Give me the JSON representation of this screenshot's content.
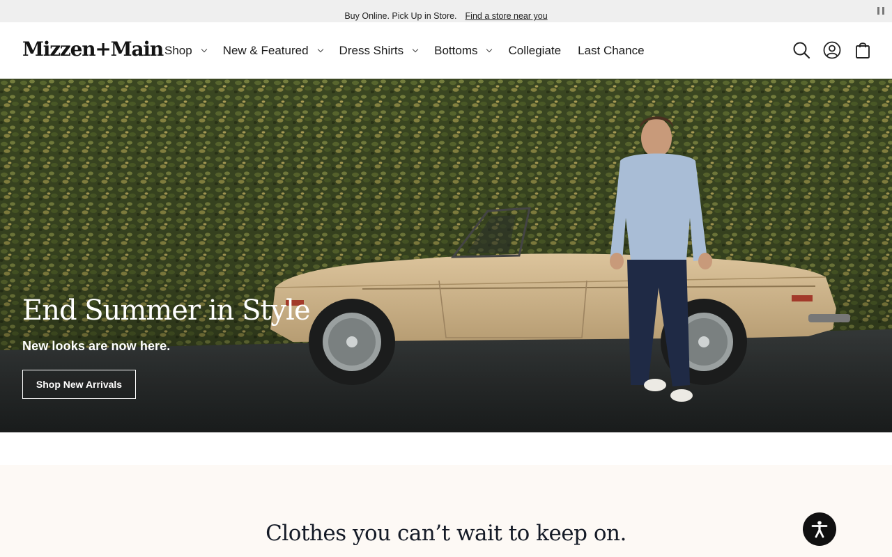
{
  "announcement": {
    "message": "Buy Online. Pick Up in Store.",
    "link": "Find a store near you",
    "pause_icon": "pause-icon"
  },
  "header": {
    "logo": "Mizzen+Main",
    "nav": [
      {
        "label": "Shop",
        "has_dropdown": true
      },
      {
        "label": "New & Featured",
        "has_dropdown": true
      },
      {
        "label": "Dress Shirts",
        "has_dropdown": true
      },
      {
        "label": "Bottoms",
        "has_dropdown": true
      },
      {
        "label": "Collegiate",
        "has_dropdown": false
      },
      {
        "label": "Last Chance",
        "has_dropdown": false
      }
    ],
    "icons": [
      "search-icon",
      "account-icon",
      "cart-icon"
    ]
  },
  "hero": {
    "title": "End Summer in Style",
    "subtitle": "New looks are now here.",
    "cta": "Shop New Arrivals"
  },
  "section": {
    "title": "Clothes you can’t wait to keep on."
  },
  "accessibility_button": {
    "icon": "accessibility-icon"
  },
  "colors": {
    "announcement_bg": "#efefef",
    "section_bg": "#fdf9f5",
    "accessibility_bg": "#111111"
  }
}
